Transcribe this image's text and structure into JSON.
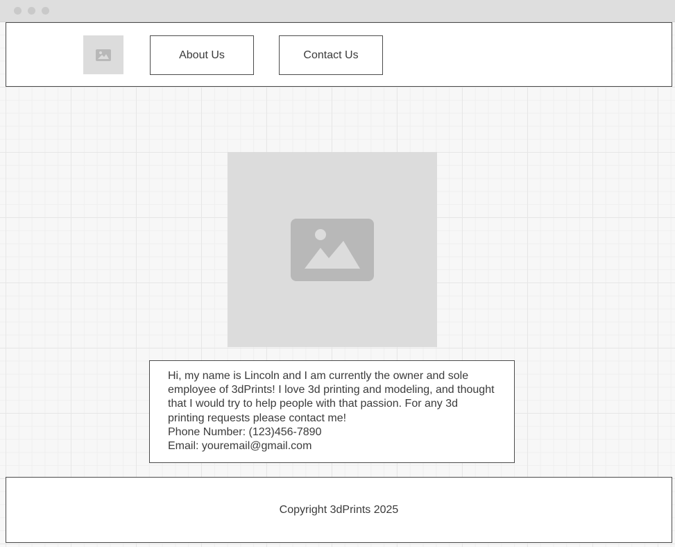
{
  "window": {
    "controls": [
      "close-dot",
      "minimize-dot",
      "maximize-dot"
    ]
  },
  "header": {
    "logo_icon": "image-placeholder-icon",
    "nav": [
      {
        "label": "About Us"
      },
      {
        "label": "Contact Us"
      }
    ]
  },
  "main": {
    "hero_icon": "image-placeholder-icon",
    "about": {
      "paragraph": "Hi, my name is Lincoln and I am currently the owner and sole employee of 3dPrints! I love 3d printing and modeling, and thought that I would try to help people with that passion. For any 3d printing requests please contact me!",
      "phone": "Phone Number: (123)456-7890",
      "email": "Email: youremail@gmail.com"
    }
  },
  "footer": {
    "copyright": "Copyright 3dPrints 2025"
  },
  "colors": {
    "placeholder_bg": "#dcdcdc",
    "placeholder_icon": "#b8b8b8",
    "border": "#4a4a4a",
    "text": "#3a3a3a"
  }
}
